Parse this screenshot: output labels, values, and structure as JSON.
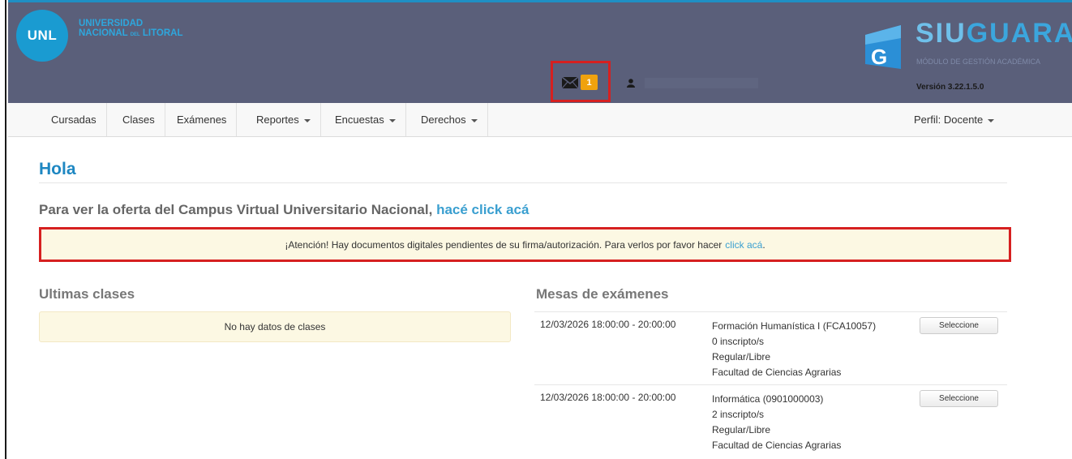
{
  "header": {
    "unl_logo_text": "UNL",
    "unl_line1": "UNIVERSIDAD",
    "unl_line2": "NACIONAL",
    "unl_del": "DEL",
    "unl_line3": "LITORAL",
    "message_count": "1",
    "siu_title_a": "SIU",
    "siu_title_b": "GUARAN",
    "siu_subtitle": "MÓDULO DE GESTIÓN ACADÉMICA",
    "version": "Versión 3.22.1.5.0",
    "colors": {
      "header_bg": "#5a5f7a",
      "badge": "#f0a20e",
      "highlight": "#d62020"
    }
  },
  "nav": {
    "items": [
      {
        "label": "Cursadas"
      },
      {
        "label": "Clases"
      },
      {
        "label": "Exámenes"
      },
      {
        "label": "Reportes"
      },
      {
        "label": "Encuestas"
      },
      {
        "label": "Derechos"
      }
    ],
    "profile": "Perfil: Docente"
  },
  "main": {
    "title": "Hola",
    "campus_text": "Para ver la oferta del Campus Virtual Universitario Nacional,",
    "campus_link": "hacé click acá",
    "alert_text": "¡Atención! Hay documentos digitales pendientes de su firma/autorización. Para verlos por favor hacer",
    "alert_link": "click acá",
    "alert_end": "."
  },
  "ultimas_clases": {
    "title": "Ultimas clases",
    "empty_text": "No hay datos de clases"
  },
  "mesas": {
    "title": "Mesas de exámenes",
    "button_label": "Seleccione",
    "rows": [
      {
        "date": "12/03/2026 18:00:00 - 20:00:00",
        "subject": "Formación Humanística I (FCA10057)",
        "inscriptos": "0 inscripto/s",
        "condicion": "Regular/Libre",
        "facultad": "Facultad de Ciencias Agrarias"
      },
      {
        "date": "12/03/2026 18:00:00 - 20:00:00",
        "subject": "Informática (0901000003)",
        "inscriptos": "2 inscripto/s",
        "condicion": "Regular/Libre",
        "facultad": "Facultad de Ciencias Agrarias"
      }
    ]
  }
}
